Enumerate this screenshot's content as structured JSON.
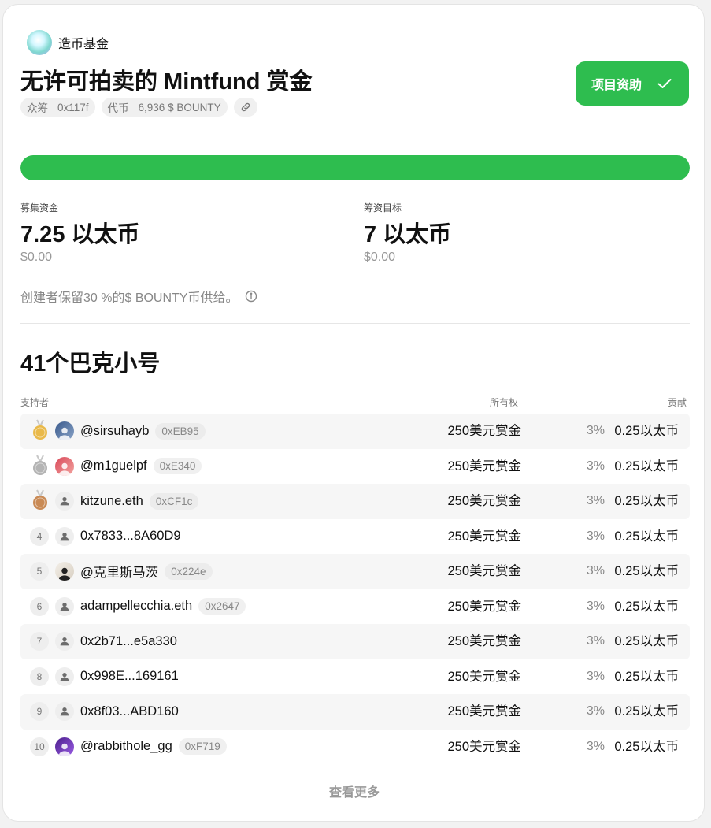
{
  "project": {
    "brand_name": "造币基金",
    "title": "无许可拍卖的 Mintfund 赏金",
    "chips": [
      {
        "key": "众筹",
        "value": "0x117f"
      },
      {
        "key": "代币",
        "value": "6,936 $ BOUNTY"
      }
    ],
    "fund_button_label": "项目资助"
  },
  "progress": {
    "fraction": 1.0,
    "color": "#2ebd4f"
  },
  "stats": {
    "raised": {
      "label": "募集资金",
      "value": "7.25 以太币",
      "usd": "$0.00"
    },
    "goal": {
      "label": "筹资目标",
      "value": "7 以太币",
      "usd": "$0.00"
    }
  },
  "note": "创建者保留30 %的$ BOUNTY币供给。",
  "backers": {
    "title": "41个巴克小号",
    "columns": {
      "supporter": "支持者",
      "ownership": "所有权",
      "contribution": "贡献"
    },
    "rows": [
      {
        "rank": "1",
        "medal": "gold",
        "avatar": "photo-blue",
        "name": "@sirsuhayb",
        "address": "0xEB95",
        "ownership": "250美元赏金",
        "percent": "3%",
        "contribution": "0.25以太币"
      },
      {
        "rank": "2",
        "medal": "silver",
        "avatar": "photo-red",
        "name": "@m1guelpf",
        "address": "0xE340",
        "ownership": "250美元赏金",
        "percent": "3%",
        "contribution": "0.25以太币"
      },
      {
        "rank": "3",
        "medal": "bronze",
        "avatar": "default",
        "name": "kitzune.eth",
        "address": "0xCF1c",
        "ownership": "250美元赏金",
        "percent": "3%",
        "contribution": "0.25以太币"
      },
      {
        "rank": "4",
        "medal": "",
        "avatar": "default",
        "name": "0x7833...8A60D9",
        "address": "",
        "ownership": "250美元赏金",
        "percent": "3%",
        "contribution": "0.25以太币"
      },
      {
        "rank": "5",
        "medal": "",
        "avatar": "photo-person",
        "name": "@克里斯马茨",
        "address": "0x224e",
        "ownership": "250美元赏金",
        "percent": "3%",
        "contribution": "0.25以太币"
      },
      {
        "rank": "6",
        "medal": "",
        "avatar": "default",
        "name": "adampellecchia.eth",
        "address": "0x2647",
        "ownership": "250美元赏金",
        "percent": "3%",
        "contribution": "0.25以太币"
      },
      {
        "rank": "7",
        "medal": "",
        "avatar": "default",
        "name": "0x2b71...e5a330",
        "address": "",
        "ownership": "250美元赏金",
        "percent": "3%",
        "contribution": "0.25以太币"
      },
      {
        "rank": "8",
        "medal": "",
        "avatar": "default",
        "name": "0x998E...169161",
        "address": "",
        "ownership": "250美元赏金",
        "percent": "3%",
        "contribution": "0.25以太币"
      },
      {
        "rank": "9",
        "medal": "",
        "avatar": "default",
        "name": "0x8f03...ABD160",
        "address": "",
        "ownership": "250美元赏金",
        "percent": "3%",
        "contribution": "0.25以太币"
      },
      {
        "rank": "10",
        "medal": "",
        "avatar": "photo-purple",
        "name": "@rabbithole_gg",
        "address": "0xF719",
        "ownership": "250美元赏金",
        "percent": "3%",
        "contribution": "0.25以太币"
      }
    ],
    "more_label": "查看更多"
  },
  "colors": {
    "accent": "#2ebd4f",
    "gold": "#e9b949",
    "silver": "#b4b4b4",
    "bronze": "#c98a55"
  }
}
